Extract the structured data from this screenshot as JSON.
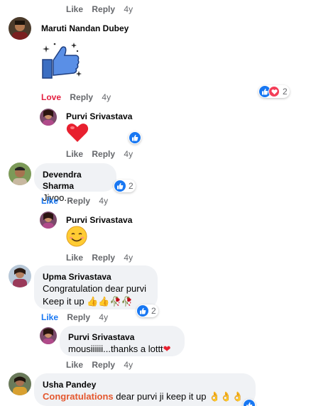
{
  "top_actions": {
    "like": "Like",
    "reply": "Reply",
    "time": "4y"
  },
  "comments": [
    {
      "author": "Maruti Nandan Dubey",
      "sticker": "thumbs-up-sticker",
      "actions": {
        "reaction": "Love",
        "reply": "Reply",
        "time": "4y"
      },
      "reactions": {
        "icons": [
          "like-icon",
          "love-icon"
        ],
        "count": "2"
      }
    },
    {
      "author": "Purvi Srivastava",
      "emoji": "❤",
      "actions": {
        "like": "Like",
        "reply": "Reply",
        "time": "4y"
      },
      "reactions": {
        "icons": [
          "like-icon"
        ]
      }
    },
    {
      "author": "Devendra Sharma",
      "text": "Jiyoo...",
      "actions": {
        "reaction": "Like",
        "reply": "Reply",
        "time": "4y"
      },
      "reactions": {
        "icons": [
          "like-icon"
        ],
        "count": "2"
      }
    },
    {
      "author": "Purvi Srivastava",
      "emoji": "☺",
      "actions": {
        "like": "Like",
        "reply": "Reply",
        "time": "4y"
      }
    },
    {
      "author": "Upma Srivastava",
      "text_line1": "Congratulation dear purvi",
      "text_line2": "Keep it up 👍👍🥀🥀",
      "actions": {
        "reaction": "Like",
        "reply": "Reply",
        "time": "4y"
      },
      "reactions": {
        "icons": [
          "like-icon"
        ],
        "count": "2"
      }
    },
    {
      "author": "Purvi Srivastava",
      "text": "mousiiiiii...thanks a lottt",
      "text_emoji": "❤",
      "actions": {
        "like": "Like",
        "reply": "Reply",
        "time": "4y"
      }
    },
    {
      "author": "Usha Pandey",
      "text_highlight": "Congratulations",
      "text_rest": " dear purvi ji keep it up 👌👌👌",
      "reactions": {
        "icons": [
          "like-icon"
        ]
      }
    }
  ],
  "colors": {
    "like_blue": "#1877f2",
    "love_red": "#e41e3f",
    "bubble_bg": "#f0f2f5",
    "meta_gray": "#65676b"
  }
}
